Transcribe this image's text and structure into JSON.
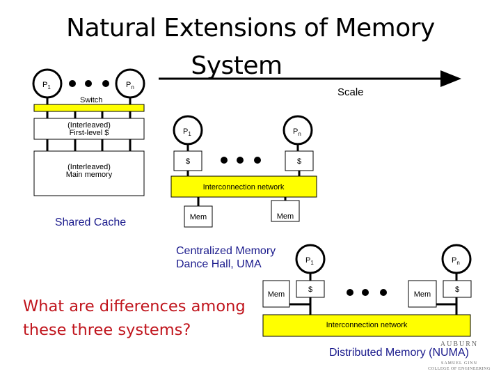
{
  "slide": {
    "title_line1": "Natural Extensions of Memory",
    "title_line2": "System",
    "scale_label": "Scale",
    "question": "What are differences among\nthese three systems?"
  },
  "colors": {
    "bus_yellow": "#ffff00",
    "label_blue": "#1a1a8c",
    "question_red": "#c0141c"
  },
  "shared_cache": {
    "processor_first": "P",
    "processor_first_sub": "1",
    "processor_last": "P",
    "processor_last_sub": "n",
    "switch_label": "Switch",
    "cache_line1": "(Interleaved)",
    "cache_line2": "First-level $",
    "memory_line1": "(Interleaved)",
    "memory_line2": "Main memory",
    "caption": "Shared Cache"
  },
  "centralized": {
    "processor_first": "P",
    "processor_first_sub": "1",
    "processor_last": "P",
    "processor_last_sub": "n",
    "cache_label": "$",
    "network_label": "Interconnection network",
    "mem_label": "Mem",
    "caption_line1": "Centralized Memory",
    "caption_line2": "Dance Hall, UMA"
  },
  "distributed": {
    "processor_first": "P",
    "processor_first_sub": "1",
    "processor_last": "P",
    "processor_last_sub": "n",
    "cache_label": "$",
    "mem_label": "Mem",
    "network_label": "Interconnection network",
    "caption": "Distributed Memory (NUMA)"
  },
  "logo": {
    "name": "AUBURN",
    "line1": "SAMUEL GINN",
    "line2": "COLLEGE OF ENGINEERING"
  }
}
